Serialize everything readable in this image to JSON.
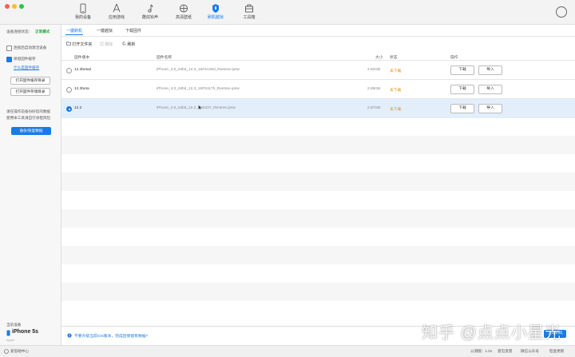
{
  "nav": {
    "items": [
      {
        "label": "我的设备",
        "icon": "phone-icon"
      },
      {
        "label": "应用游戏",
        "icon": "apps-icon"
      },
      {
        "label": "酷炫铃声",
        "icon": "music-note-icon"
      },
      {
        "label": "高清壁纸",
        "icon": "flower-icon"
      },
      {
        "label": "刷机越狱",
        "icon": "shield-icon"
      },
      {
        "label": "工具箱",
        "icon": "toolbox-icon"
      }
    ],
    "active_index": 4
  },
  "sidebar": {
    "status_label": "设备连接状态：",
    "status_value": "正常模式",
    "auto_activate": "连接后自动激活设备",
    "keep_cache": "保留固件缓存",
    "what_is_cache": "什么是固件缓存",
    "open_cache_dir": "打开固件缓存目录",
    "open_storage_dir": "打开固件存储目录",
    "warning_line1": "请在操作前备份好您的数据",
    "warning_line2": "使用本工具请自行承担风险",
    "backup_button": "备份/恢复数据",
    "device_label": "当前设备",
    "device_name": "iPhone 5s",
    "device_sub": "Apple"
  },
  "tabs": [
    "一键刷机",
    "一键越狱",
    "下载固件"
  ],
  "toolbar": {
    "open_folder": "打开文件夹",
    "delete": "删除",
    "refresh": "刷新"
  },
  "table": {
    "headers": [
      "固件版本",
      "固件名称",
      "大小",
      "状态",
      "操作"
    ],
    "rows": [
      {
        "version": "12.3beta2",
        "name": "iPhone_4.0_64bit_12.3_16F5129d_Restore.ipsw",
        "size": "2.82GB",
        "status": "未下载",
        "download": "下载",
        "import": "导入",
        "selected": false
      },
      {
        "version": "12.3beta",
        "name": "iPhone_4.0_64bit_12.3_16F5117h_Restore.ipsw",
        "size": "2.89GB",
        "status": "未下载",
        "download": "下载",
        "import": "导入",
        "selected": false
      },
      {
        "version": "12.2",
        "name": "iPhone_4.0_64bit_12.2_16E227_Restore.ipsw",
        "size": "2.87GB",
        "status": "未下载",
        "download": "下载",
        "import": "导入",
        "selected": true
      }
    ]
  },
  "bottom": {
    "notice": "不要升级当前iOS版本，完成后保留有数据?",
    "flash_button": "立即刷机"
  },
  "statusbar": {
    "left": "爱思助中心",
    "version": "公测版：1.01",
    "feedback": "意见反馈",
    "wechat": "微信公众号",
    "update": "检查更新"
  },
  "watermark": "知乎 @点点小星光",
  "colors": {
    "accent": "#1a7be6",
    "warning": "#f08a0a",
    "ok_green": "#2aa63a"
  }
}
